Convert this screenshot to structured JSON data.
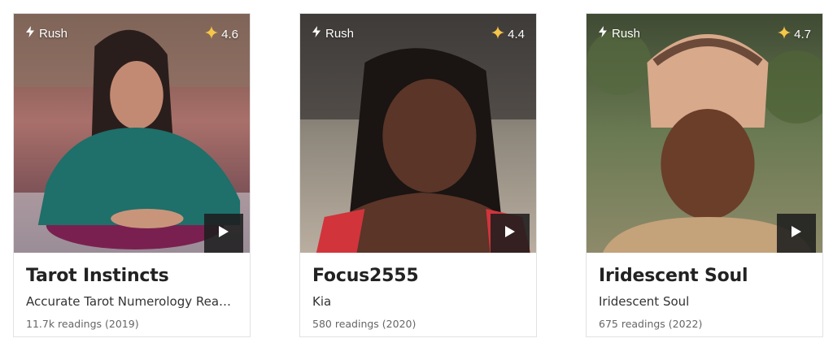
{
  "cards": [
    {
      "badge": "Rush",
      "rating": "4.6",
      "name": "Tarot Instincts",
      "tagline": "Accurate Tarot Numerology Readi...",
      "readings": "11.7k readings (2019)",
      "bg_color": "#7d5a4a"
    },
    {
      "badge": "Rush",
      "rating": "4.4",
      "name": "Focus2555",
      "tagline": "Kia",
      "readings": "580 readings (2020)",
      "bg_color": "#8a8478"
    },
    {
      "badge": "Rush",
      "rating": "4.7",
      "name": "Iridescent Soul",
      "tagline": "Iridescent Soul",
      "readings": "675 readings (2022)",
      "bg_color": "#4e5a3a"
    }
  ],
  "icons": {
    "badge": "lightning-icon",
    "rating": "sparkle-icon",
    "video": "play-icon"
  },
  "colors": {
    "sparkle": "#f7c548",
    "play_bg": "#1e1e1e"
  }
}
